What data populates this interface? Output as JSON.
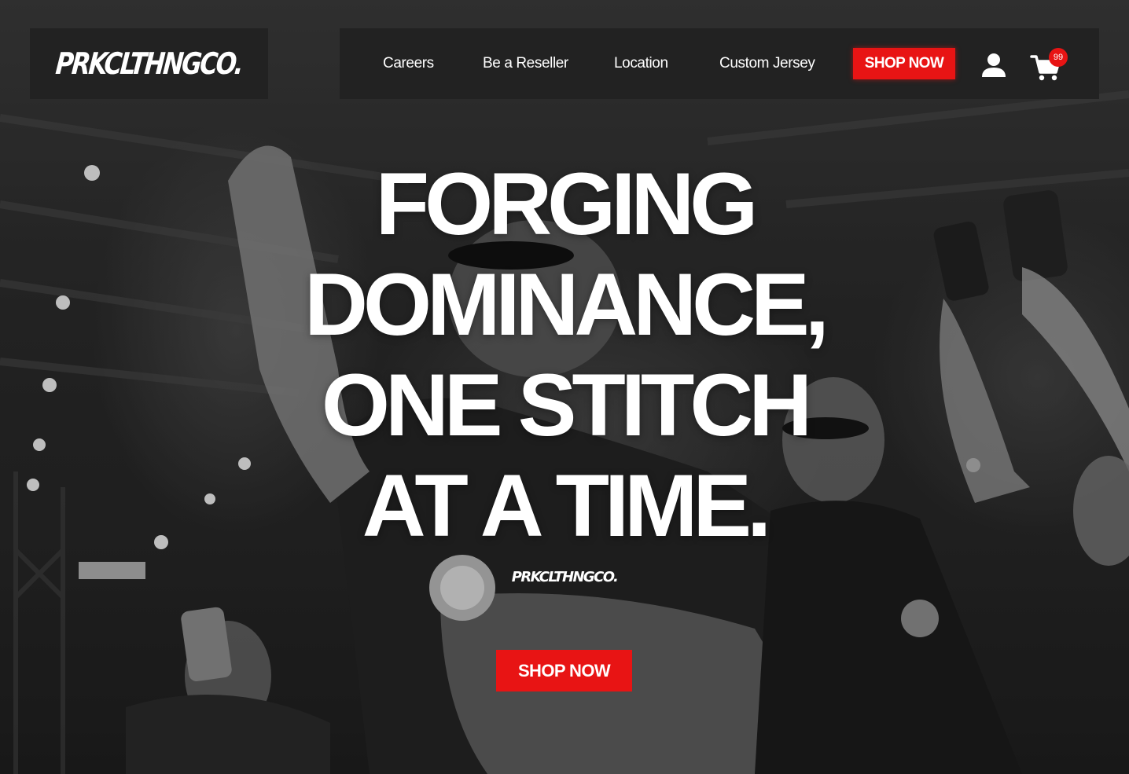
{
  "brand": {
    "logo_text": "PRKCLTHNGCO."
  },
  "nav": {
    "links": [
      {
        "label": "Careers"
      },
      {
        "label": "Be a Reseller"
      },
      {
        "label": "Location"
      },
      {
        "label": "Custom Jersey"
      }
    ],
    "shop_now_label": "SHOP NOW",
    "cart_count": "99",
    "user_icon": "user-icon",
    "cart_icon": "cart-icon"
  },
  "hero": {
    "headline_lines": [
      "FORGING",
      "DOMINANCE,",
      "ONE STITCH",
      "AT A TIME."
    ],
    "brand_mark": "PRKCLTHNGCO.",
    "cta_label": "SHOP NOW"
  },
  "colors": {
    "accent": "#e81414",
    "panel": "#222222",
    "text": "#ffffff"
  }
}
